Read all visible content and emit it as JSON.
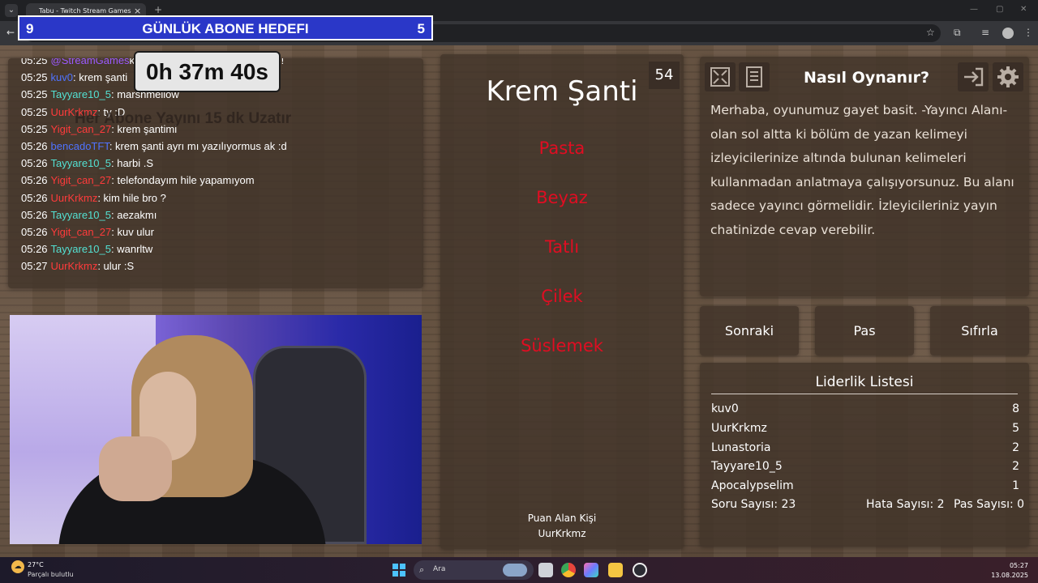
{
  "browser": {
    "tab_title": "Tabu - Twitch Stream Games",
    "tab_close": "×",
    "new_tab": "+",
    "menu_icon": "⌄",
    "back_icon": "←",
    "star_icon": "☆",
    "ext_icon": "⧉",
    "media_icon": "≡",
    "more_icon": "⋮",
    "minimize": "—",
    "maximize": "▢",
    "close": "✕"
  },
  "subgoal": {
    "left": "9",
    "title": "GÜNLÜK ABONE HEDEFI",
    "right": "5",
    "bar_color": "#2a37c8"
  },
  "chat": {
    "messages": [
      {
        "time": "05:25",
        "user": "@StreamGames",
        "user_color": "#9b59ff",
        "text": "kuv0 krem şanti kelimesini buldu!"
      },
      {
        "time": "05:25",
        "user": "kuv0",
        "user_color": "#4f73ff",
        "text": ": krem şanti"
      },
      {
        "time": "05:25",
        "user": "Tayyare10_5",
        "user_color": "#53e0d2",
        "text": ": marshmellow"
      },
      {
        "time": "05:25",
        "user": "UurKrkmz",
        "user_color": "#ff3b3b",
        "text": ": ty :D"
      },
      {
        "time": "05:25",
        "user": "Yigit_can_27",
        "user_color": "#ff3b3b",
        "text": ": krem şantimi"
      },
      {
        "time": "05:26",
        "user": "bencadoTFT",
        "user_color": "#4f73ff",
        "text": ": krem şanti ayrı mı yazılıyormus ak :d"
      },
      {
        "time": "05:26",
        "user": "Tayyare10_5",
        "user_color": "#53e0d2",
        "text": ": harbi .S"
      },
      {
        "time": "05:26",
        "user": "Yigit_can_27",
        "user_color": "#ff3b3b",
        "text": ": telefondayım hile yapamıyom"
      },
      {
        "time": "05:26",
        "user": "UurKrkmz",
        "user_color": "#ff3b3b",
        "text": ": kim hile bro ?"
      },
      {
        "time": "05:26",
        "user": "Tayyare10_5",
        "user_color": "#53e0d2",
        "text": ": aezakmı"
      },
      {
        "time": "05:26",
        "user": "Yigit_can_27",
        "user_color": "#ff3b3b",
        "text": ": kuv ulur"
      },
      {
        "time": "05:26",
        "user": "Tayyare10_5",
        "user_color": "#53e0d2",
        "text": ": wanrltw"
      },
      {
        "time": "05:27",
        "user": "UurKrkmz",
        "user_color": "#ff3b3b",
        "text": ": ulur :S"
      }
    ]
  },
  "timer": "0h 37m 40s",
  "extend_text": "Her Abone Yayını 15 dk Uzatır",
  "card": {
    "counter": "54",
    "word": "Krem Şanti",
    "taboo_words": [
      "Pasta",
      "Beyaz",
      "Tatlı",
      "Çilek",
      "Süslemek"
    ],
    "taboo_color": "#e00d22",
    "scorer_label": "Puan Alan Kişi",
    "scorer_name": "UurKrkmz"
  },
  "howto": {
    "title": "Nasıl Oynanır?",
    "text": "Merhaba, oyunumuz gayet basit. -Yayıncı Alanı- olan sol altta ki bölüm de yazan kelimeyi izleyicilerinize altında bulunan kelimeleri kullanmadan anlatmaya çalışıyorsunuz. Bu alanı sadece yayıncı görmelidir. İzleyicileriniz yayın chatinizde cevap verebilir."
  },
  "buttons": {
    "next": "Sonraki",
    "pass": "Pas",
    "reset": "Sıfırla"
  },
  "leaderboard": {
    "title": "Liderlik Listesi",
    "rows": [
      {
        "name": "kuv0",
        "score": "8"
      },
      {
        "name": "UurKrkmz",
        "score": "5"
      },
      {
        "name": "Lunastoria",
        "score": "2"
      },
      {
        "name": "Tayyare10_5",
        "score": "2"
      },
      {
        "name": "Apocalypselim",
        "score": "1"
      }
    ],
    "question_count": "Soru Sayısı: 23",
    "error_count": "Hata Sayısı: 2",
    "pass_count": "Pas Sayısı: 0"
  },
  "taskbar": {
    "temperature": "27°C",
    "weather": "Parçalı bulutlu",
    "search_placeholder": "Ara",
    "search_icon": "⌕",
    "time": "05:27",
    "date": "13.08.2025"
  }
}
